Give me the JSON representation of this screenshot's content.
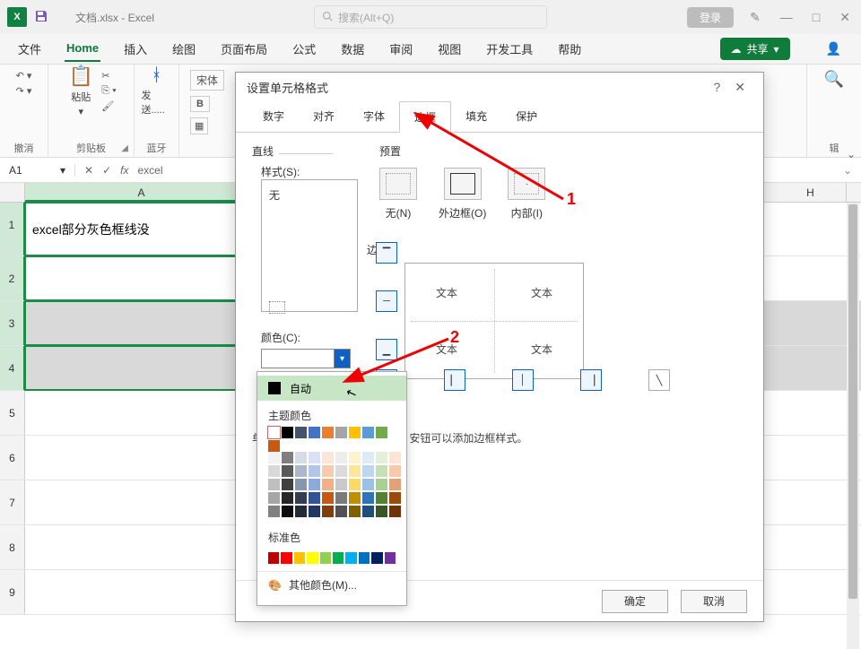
{
  "titlebar": {
    "doc_title": "文档.xlsx  -  Excel",
    "search_placeholder": "搜索(Alt+Q)",
    "login": "登录"
  },
  "menu": {
    "file": "文件",
    "home": "Home",
    "insert": "插入",
    "draw": "绘图",
    "layout": "页面布局",
    "formula": "公式",
    "data": "数据",
    "review": "审阅",
    "view": "视图",
    "dev": "开发工具",
    "help": "帮助",
    "share": "共享"
  },
  "ribbon": {
    "undo": "撤消",
    "clipboard": "剪贴板",
    "paste": "粘贴",
    "bluetooth": "蓝牙",
    "send": "发送.....",
    "font_name": "宋体",
    "edit": "辑"
  },
  "formula_bar": {
    "cell_ref": "A1",
    "content_prefix": "excel"
  },
  "sheet": {
    "col_A": "A",
    "col_H": "H",
    "row1_text": "excel部分灰色框线没"
  },
  "dialog": {
    "title": "设置单元格格式",
    "tabs": {
      "number": "数字",
      "align": "对齐",
      "font": "字体",
      "border": "边框",
      "fill": "填充",
      "protect": "保护"
    },
    "line": "直线",
    "style": "样式(S):",
    "style_none": "无",
    "color": "颜色(C):",
    "preset": "预置",
    "preset_none": "无(N)",
    "preset_outer": "外边框(O)",
    "preset_inner": "内部(I)",
    "border_label": "边框",
    "preview_text": "文本",
    "help": "安钮可以添加边框样式。",
    "help_prefix": "单",
    "ok": "确定",
    "cancel": "取消"
  },
  "color_popup": {
    "auto": "自动",
    "theme": "主题颜色",
    "standard": "标准色",
    "more": "其他颜色(M)..."
  },
  "annotations": {
    "a1": "1",
    "a2": "2"
  },
  "colors": {
    "theme_row": [
      "#ffffff",
      "#000000",
      "#44546a",
      "#4472c4",
      "#ed7d31",
      "#a5a5a5",
      "#ffc000",
      "#5b9bd5",
      "#70ad47",
      "#c55a11"
    ],
    "shades": [
      [
        "#f2f2f2",
        "#d9d9d9",
        "#bfbfbf",
        "#a6a6a6",
        "#808080"
      ],
      [
        "#7f7f7f",
        "#595959",
        "#404040",
        "#262626",
        "#0d0d0d"
      ],
      [
        "#d6dce5",
        "#adb9ca",
        "#8497b0",
        "#333f50",
        "#222a35"
      ],
      [
        "#d9e1f2",
        "#b4c6e7",
        "#8ea9db",
        "#305496",
        "#203764"
      ],
      [
        "#fce4d6",
        "#f8cbad",
        "#f4b084",
        "#c65911",
        "#833c0c"
      ],
      [
        "#ededed",
        "#dbdbdb",
        "#c9c9c9",
        "#7b7b7b",
        "#525252"
      ],
      [
        "#fff2cc",
        "#ffe699",
        "#ffd966",
        "#bf8f00",
        "#806000"
      ],
      [
        "#ddebf7",
        "#bdd7ee",
        "#9bc2e6",
        "#2f75b5",
        "#1f4e78"
      ],
      [
        "#e2efda",
        "#c6e0b4",
        "#a9d08e",
        "#548235",
        "#375623"
      ],
      [
        "#fbe5d6",
        "#f7caac",
        "#e2a176",
        "#9c4a09",
        "#6e3308"
      ]
    ],
    "standard": [
      "#c00000",
      "#ff0000",
      "#ffc000",
      "#ffff00",
      "#92d050",
      "#00b050",
      "#00b0f0",
      "#0070c0",
      "#002060",
      "#7030a0"
    ]
  }
}
